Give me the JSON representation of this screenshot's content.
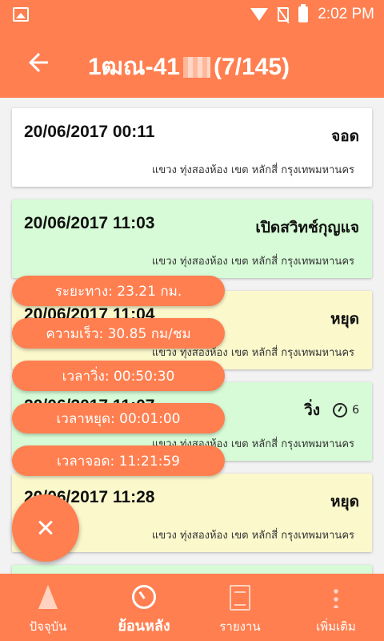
{
  "status_bar": {
    "time": "2:02 PM"
  },
  "app_bar": {
    "title_prefix": "1ฒณ-41",
    "title_suffix": "(7/145)"
  },
  "entries": [
    {
      "time": "20/06/2017 00:11",
      "state": "จอด",
      "address": "แขวง ทุ่งสองห้อง เขต หลักสี่ กรุงเทพมหานคร"
    },
    {
      "time": "20/06/2017 11:03",
      "state": "เปิดสวิทช์กุญแจ",
      "address": "แขวง ทุ่งสองห้อง เขต หลักสี่ กรุงเทพมหานคร"
    },
    {
      "time": "20/06/2017 11:04",
      "state": "หยุด",
      "address": "แขวง ทุ่งสองห้อง เขต หลักสี่ กรุงเทพมหานคร"
    },
    {
      "time": "20/06/2017 11:07",
      "state": "วิ่ง",
      "gauge_count": "6",
      "address": "แขวง ทุ่งสองห้อง เขต หลักสี่ กรุงเทพมหานคร"
    },
    {
      "time": "20/06/2017 11:28",
      "state": "หยุด",
      "address": "แขวง ทุ่งสองห้อง เขต หลักสี่ กรุงเทพมหานคร"
    }
  ],
  "stats": {
    "distance": "ระยะทาง: 23.21 กม.",
    "speed": "ความเร็ว: 30.85 กม/ชม",
    "run_time": "เวลาวิ่ง: 00:50:30",
    "stop_time": "เวลาหยุด: 00:01:00",
    "park_time": "เวลาจอด: 11:21:59"
  },
  "bottom_nav": {
    "current": "ปัจจุบัน",
    "history": "ย้อนหลัง",
    "report": "รายงาน",
    "more": "เพิ่มเติม",
    "active": "history"
  },
  "colors": {
    "accent": "#ff7f50",
    "card_white": "#ffffff",
    "card_green": "#d6fbd6",
    "card_yellow": "#fbf8cc"
  },
  "icons": [
    "image-icon",
    "wifi-icon",
    "no-sim-icon",
    "battery-icon",
    "back-arrow-icon",
    "gauge-icon",
    "close-icon",
    "navigation-arrow-icon",
    "clock-icon",
    "document-icon",
    "more-vert-icon"
  ]
}
